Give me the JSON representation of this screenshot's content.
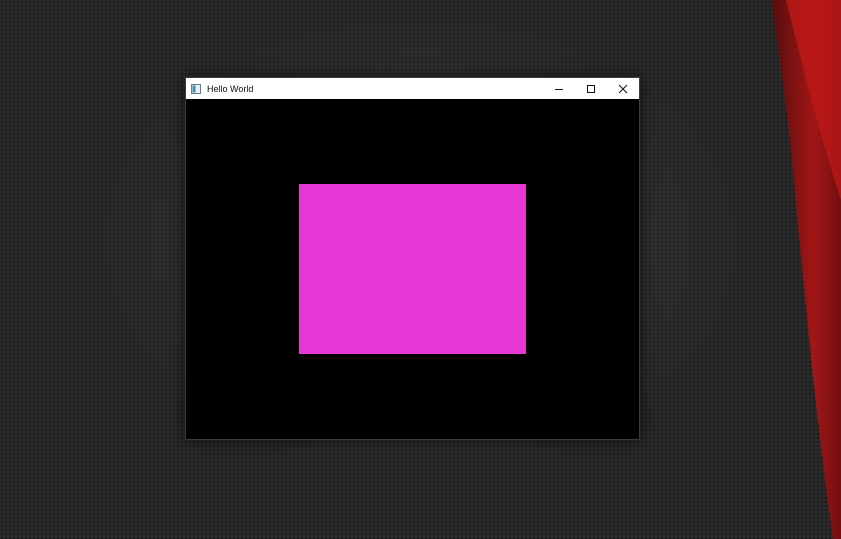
{
  "window": {
    "title": "Hello World",
    "minimize_icon": "minimize-icon",
    "maximize_icon": "maximize-icon",
    "close_icon": "close-icon",
    "app_icon": "window-app-icon"
  },
  "content": {
    "background_color": "#000000",
    "rectangle_color": "#e837d4"
  },
  "desktop": {
    "background_color": "#2a2a2a",
    "accent_color": "#b01414"
  }
}
